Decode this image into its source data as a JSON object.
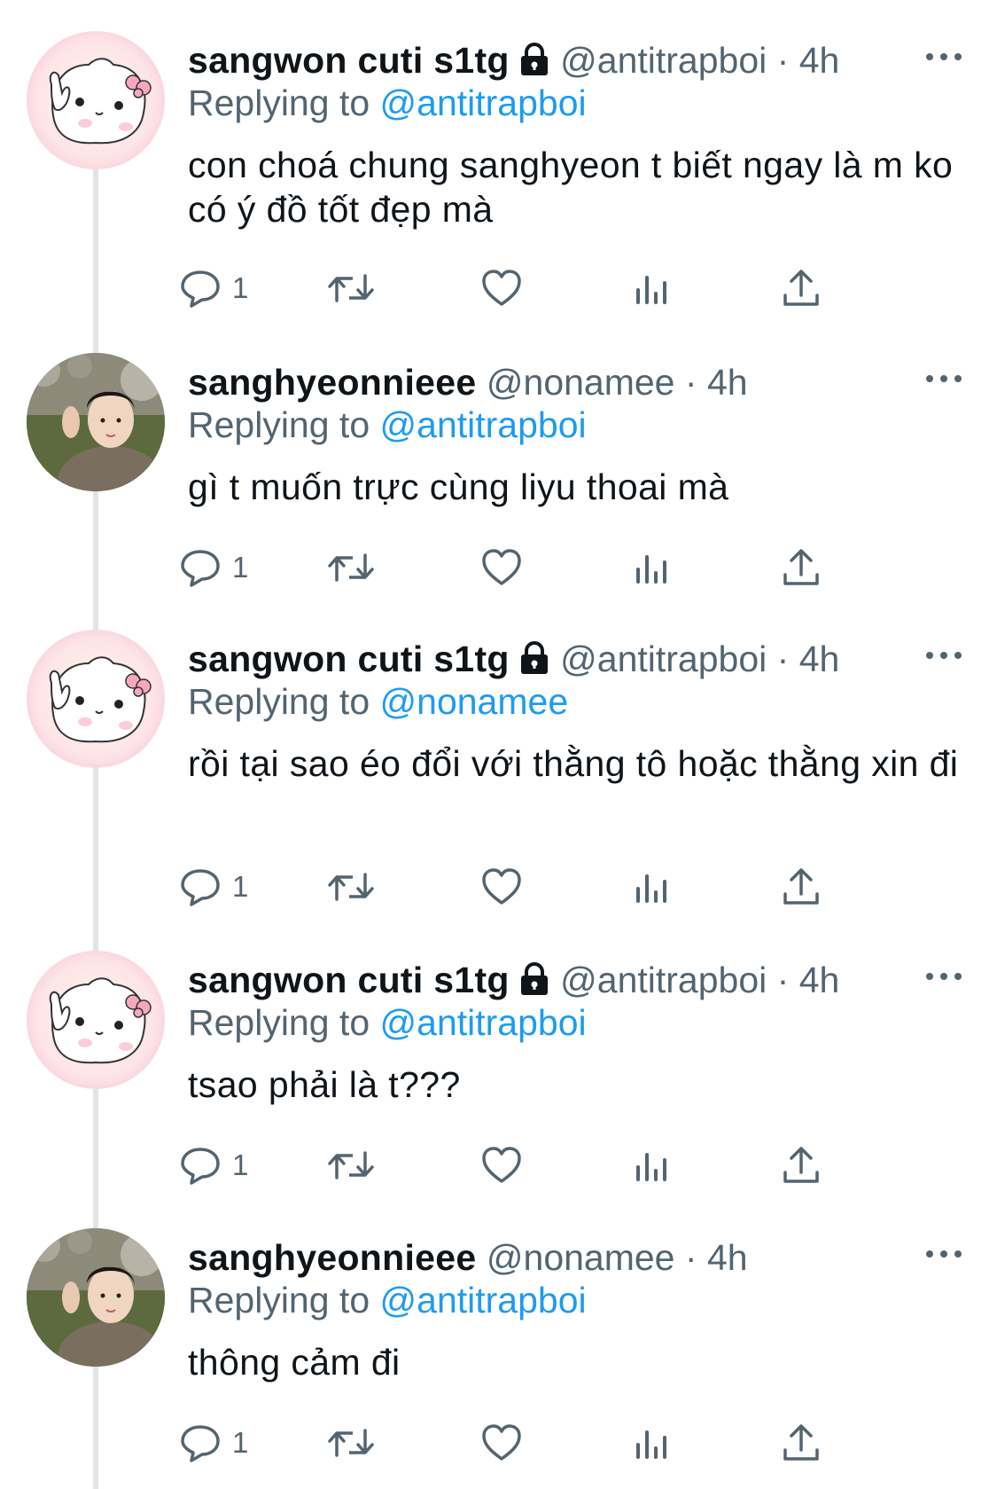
{
  "tweets": [
    {
      "name": "sangwon cuti s1tg",
      "protected": true,
      "handle": "@antitrapboi",
      "separator": "·",
      "time": "4h",
      "replying_prefix": "Replying to",
      "replying_to": "@antitrapboi",
      "text": "con choá chung sanghyeon t biết ngay là m ko có ý đồ tốt đẹp mà",
      "reply_count": "1",
      "avatar": "pink-cat-avatar"
    },
    {
      "name": "sanghyeonnieee",
      "protected": false,
      "handle": "@nonamee",
      "separator": "·",
      "time": "4h",
      "replying_prefix": "Replying to",
      "replying_to": "@antitrapboi",
      "text": "gì t muốn trực cùng liyu thoai mà",
      "reply_count": "1",
      "avatar": "photo-avatar"
    },
    {
      "name": "sangwon cuti s1tg",
      "protected": true,
      "handle": "@antitrapboi",
      "separator": "·",
      "time": "4h",
      "replying_prefix": "Replying to",
      "replying_to": "@nonamee",
      "text": "rồi tại sao éo đổi với thằng tô hoặc thằng xin đi",
      "reply_count": "1",
      "avatar": "pink-cat-avatar"
    },
    {
      "name": "sangwon cuti s1tg",
      "protected": true,
      "handle": "@antitrapboi",
      "separator": "·",
      "time": "4h",
      "replying_prefix": "Replying to",
      "replying_to": "@antitrapboi",
      "text": "tsao phải là t???",
      "reply_count": "1",
      "avatar": "pink-cat-avatar"
    },
    {
      "name": "sanghyeonnieee",
      "protected": false,
      "handle": "@nonamee",
      "separator": "·",
      "time": "4h",
      "replying_prefix": "Replying to",
      "replying_to": "@antitrapboi",
      "text": "thông cảm đi",
      "reply_count": "1",
      "avatar": "photo-avatar"
    }
  ],
  "colors": {
    "link": "#1d9bf0",
    "secondary": "#536471",
    "text": "#0f1419",
    "thread_line": "#e1e4e8"
  },
  "icons": [
    "lock-icon",
    "more-icon",
    "reply-icon",
    "retweet-icon",
    "like-icon",
    "views-icon",
    "share-icon"
  ]
}
